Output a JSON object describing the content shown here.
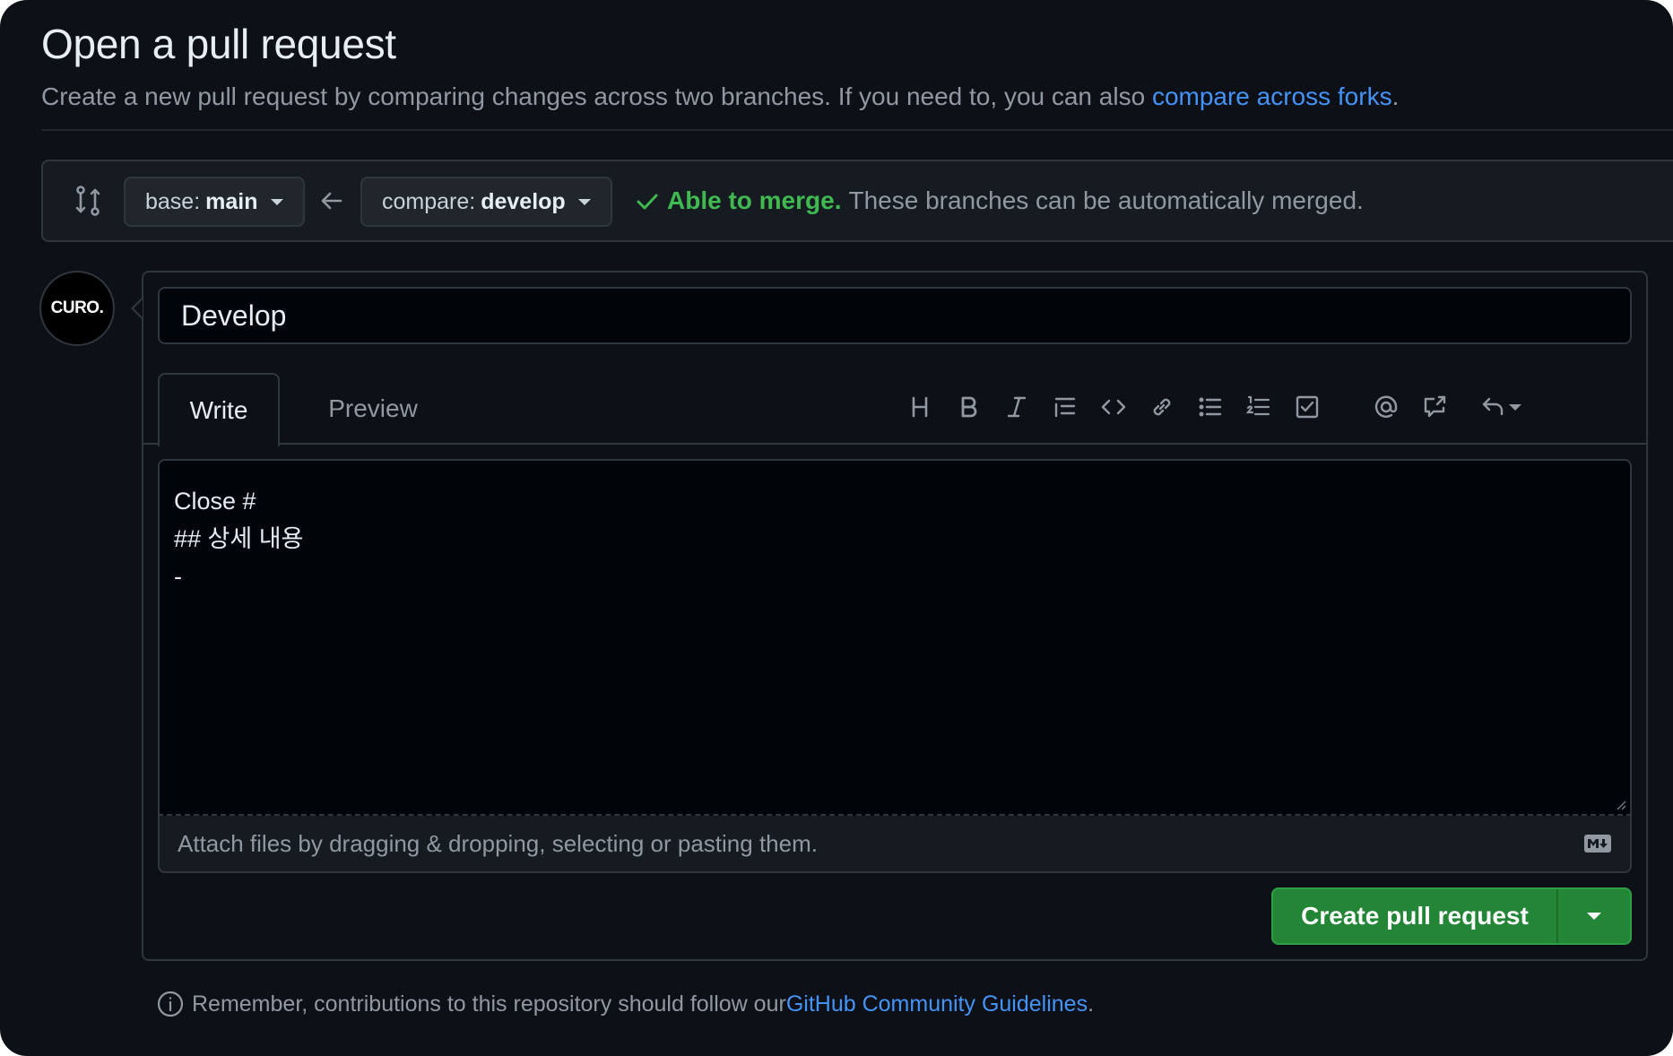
{
  "page": {
    "title": "Open a pull request",
    "subtitle_prefix": "Create a new pull request by comparing changes across two branches. If you need to, you can also ",
    "subtitle_link": "compare across forks",
    "subtitle_suffix": "."
  },
  "range": {
    "base_prefix": "base:",
    "base_branch": "main",
    "compare_prefix": "compare:",
    "compare_branch": "develop",
    "merge_ok": "Able to merge.",
    "merge_msg": "These branches can be automatically merged."
  },
  "avatar": {
    "text": "CURO."
  },
  "form": {
    "title_value": "Develop",
    "tabs": {
      "write": "Write",
      "preview": "Preview"
    },
    "body_lines": [
      "Close #",
      "",
      "## 상세 내용",
      "-"
    ],
    "attach_text": "Attach files by dragging & dropping, selecting or pasting them.",
    "create_label": "Create pull request"
  },
  "footer": {
    "prefix": "Remember, contributions to this repository should follow our ",
    "link": "GitHub Community Guidelines",
    "suffix": "."
  },
  "colors": {
    "background": "#0d1117",
    "accent_blue": "#4493f8",
    "success_green": "#3fb950",
    "button_green": "#238636"
  }
}
